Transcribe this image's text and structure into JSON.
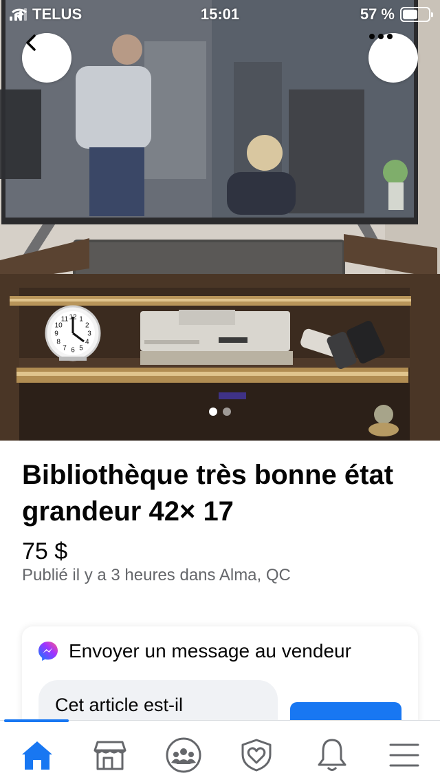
{
  "status_bar": {
    "carrier": "TELUS",
    "time": "15:01",
    "battery_text": "57 %",
    "battery_level": 0.57
  },
  "photo": {
    "current_index": 1,
    "total": 2,
    "clock_numbers": [
      "12",
      "1",
      "2",
      "3",
      "4",
      "5",
      "6",
      "7",
      "8",
      "9",
      "10",
      "11"
    ]
  },
  "header": {
    "back_icon": "chevron-left-icon",
    "more_icon": "more-horizontal-icon"
  },
  "listing": {
    "title": "Bibliothèque très bonne état grandeur 42× 17",
    "price": "75 $",
    "meta": "Publié il y a 3 heures dans Alma, QC"
  },
  "message_card": {
    "icon": "messenger-icon",
    "title": "Envoyer un message au vendeur",
    "message": "Cet article est-il",
    "send_color": "#1877f2"
  },
  "bottom_nav": {
    "active": "home",
    "items": [
      {
        "id": "home",
        "icon": "home-icon"
      },
      {
        "id": "marketplace",
        "icon": "marketplace-icon"
      },
      {
        "id": "groups",
        "icon": "groups-icon"
      },
      {
        "id": "dating",
        "icon": "heart-shield-icon"
      },
      {
        "id": "notifications",
        "icon": "bell-icon"
      },
      {
        "id": "menu",
        "icon": "menu-icon"
      }
    ]
  },
  "colors": {
    "accent": "#1877f2",
    "secondary_text": "#65676b",
    "bubble": "#f0f2f5"
  }
}
